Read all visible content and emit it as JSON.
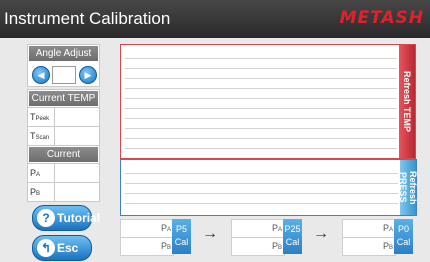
{
  "header": {
    "title": "Instrument Calibration",
    "logo": "METASH"
  },
  "angle_adjust": {
    "label": "Angle Adjust",
    "left_icon": "chevron-left-icon",
    "right_icon": "chevron-right-icon",
    "value": ""
  },
  "current_temp": {
    "label": "Current TEMP",
    "rows": [
      {
        "prefix": "T",
        "sub": "Peek",
        "value": ""
      },
      {
        "prefix": "T",
        "sub": "Scan",
        "value": ""
      }
    ]
  },
  "current_press": {
    "label": "Current PRESS",
    "rows": [
      {
        "prefix": "P",
        "sub": "A",
        "value": ""
      },
      {
        "prefix": "P",
        "sub": "B",
        "value": ""
      }
    ]
  },
  "charts": {
    "temp_refresh": "Refresh TEMP",
    "press_refresh": "Refresh PRESS"
  },
  "buttons": {
    "tutorial": "Tutorial",
    "tutorial_icon": "question-icon",
    "esc": "Esc",
    "esc_icon": "back-arrow-icon"
  },
  "calibration": [
    {
      "pa_label": "P",
      "pa_sub": "A",
      "pb_label": "P",
      "pb_sub": "B",
      "btn_line1": "P5",
      "btn_line2": "Cal"
    },
    {
      "pa_label": "P",
      "pa_sub": "A",
      "pb_label": "P",
      "pb_sub": "B",
      "btn_line1": "P25",
      "btn_line2": "Cal"
    },
    {
      "pa_label": "P",
      "pa_sub": "A",
      "pb_label": "P",
      "pb_sub": "B",
      "btn_line1": "P0",
      "btn_line2": "Cal"
    }
  ],
  "arrow_symbol": "→"
}
